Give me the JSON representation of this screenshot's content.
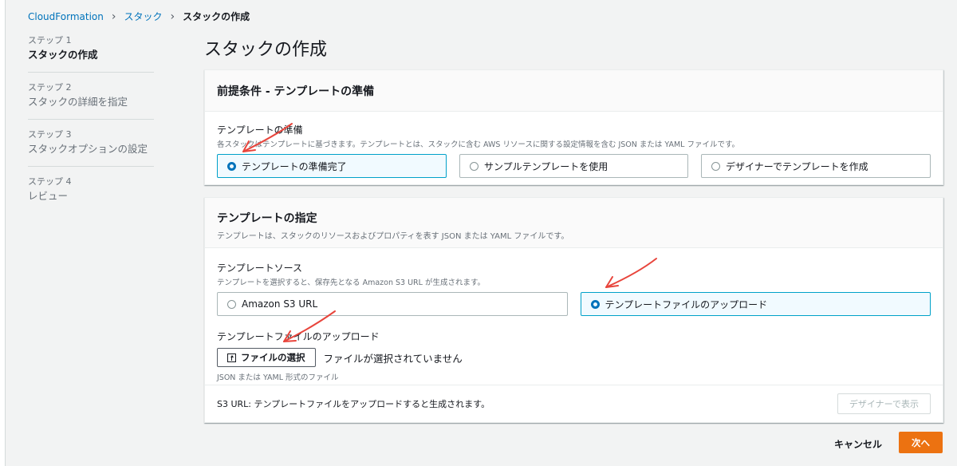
{
  "breadcrumb": {
    "item1": "CloudFormation",
    "item2": "スタック",
    "current": "スタックの作成"
  },
  "steps": [
    {
      "num": "ステップ 1",
      "name": "スタックの作成"
    },
    {
      "num": "ステップ 2",
      "name": "スタックの詳細を指定"
    },
    {
      "num": "ステップ 3",
      "name": "スタックオプションの設定"
    },
    {
      "num": "ステップ 4",
      "name": "レビュー"
    }
  ],
  "page_title": "スタックの作成",
  "prereq": {
    "title": "前提条件 - テンプレートの準備",
    "label": "テンプレートの準備",
    "desc": "各スタックはテンプレートに基づきます。テンプレートとは、スタックに含む AWS リソースに関する設定情報を含む JSON または YAML ファイルです。",
    "options": [
      "テンプレートの準備完了",
      "サンプルテンプレートを使用",
      "デザイナーでテンプレートを作成"
    ],
    "selected": "テンプレートの準備完了"
  },
  "spec": {
    "title": "テンプレートの指定",
    "desc": "テンプレートは、スタックのリソースおよびプロパティを表す JSON または YAML ファイルです。",
    "source_label": "テンプレートソース",
    "source_desc": "テンプレートを選択すると、保存先となる Amazon S3 URL が生成されます。",
    "source_options": [
      "Amazon S3 URL",
      "テンプレートファイルのアップロード"
    ],
    "source_selected": "テンプレートファイルのアップロード",
    "upload_label": "テンプレートファイルのアップロード",
    "choose_file": "ファイルの選択",
    "no_file": "ファイルが選択されていません",
    "file_hint": "JSON または YAML 形式のファイル",
    "s3_url_text": "S3 URL:  テンプレートファイルをアップロードすると生成されます。",
    "designer_button": "デザイナーで表示"
  },
  "actions": {
    "cancel": "キャンセル",
    "next": "次へ"
  },
  "colors": {
    "accent": "#0073bb",
    "primary_button": "#ec7211",
    "selected_border": "#00a1c9",
    "annotation_arrow": "#e8453c"
  }
}
